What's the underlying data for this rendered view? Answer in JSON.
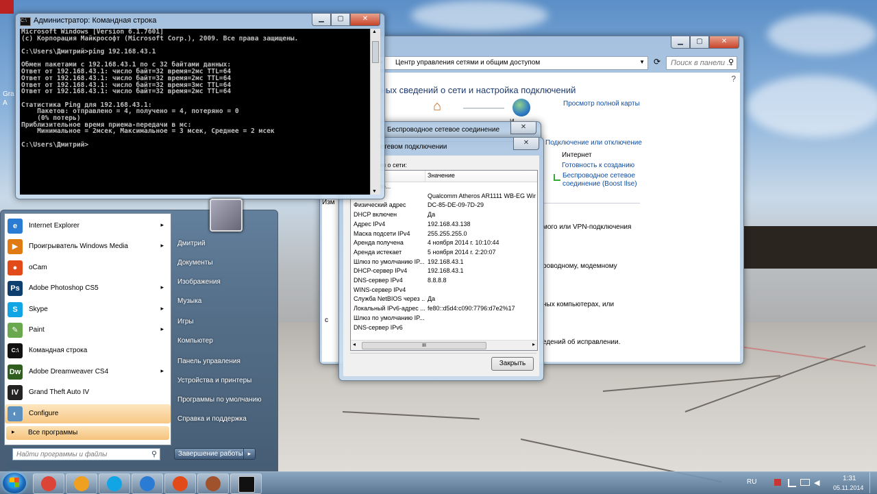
{
  "cmd": {
    "title": "Администратор: Командная строка",
    "lines": [
      "Microsoft Windows [Version 6.1.7601]",
      "(c) Корпорация Майкрософт (Microsoft Corp.), 2009. Все права защищены.",
      "",
      "C:\\Users\\Дмитрий>ping 192.168.43.1",
      "",
      "Обмен пакетами с 192.168.43.1 по с 32 байтами данных:",
      "Ответ от 192.168.43.1: число байт=32 время=2мс TTL=64",
      "Ответ от 192.168.43.1: число байт=32 время=2мс TTL=64",
      "Ответ от 192.168.43.1: число байт=32 время=3мс TTL=64",
      "Ответ от 192.168.43.1: число байт=32 время=2мс TTL=64",
      "",
      "Статистика Ping для 192.168.43.1:",
      "    Пакетов: отправлено = 4, получено = 4, потеряно = 0",
      "    (0% потерь)",
      "Приблизительное время приема-передачи в мс:",
      "    Минимальное = 2мсек, Максимальное = 3 мсек, Среднее = 2 мсек",
      "",
      "C:\\Users\\Дмитрий>"
    ]
  },
  "control_panel": {
    "address": "Центр управления сетями и общим доступом",
    "search_placeholder": "Поиск в панели ...",
    "heading": "ных сведений о сети и настройка подключений",
    "view_map": "Просмотр полной карты",
    "house_label": "",
    "globe_label": "И",
    "connect_disconnect": "Подключение или отключение",
    "internet": "Интернет",
    "ready": "Готовность к созданию",
    "wireless_conn": "Беспроводное сетевое соединение (Boost Ilse)",
    "vpn_text": "мого или VPN-подключения",
    "modem_text": "роводному, модемному",
    "computers_text": "ных компьютерах, или",
    "fix_text": "едений об исправлении.",
    "left_frag1": "Изм",
    "left_frag2": "с"
  },
  "status_dialog": {
    "title": "Беспроводное сетевое соединение"
  },
  "details_dialog": {
    "title": "етевом подключении",
    "label": "ные сведения о сети:",
    "col_prop": "",
    "col_value": "Значение",
    "rows": [
      {
        "prop": "ный для по...",
        "value": ""
      },
      {
        "prop": "",
        "value": "Qualcomm Atheros AR1111 WB-EG Wire"
      },
      {
        "prop": "Физический адрес",
        "value": "DC-85-DE-09-7D-29"
      },
      {
        "prop": "DHCP включен",
        "value": "Да"
      },
      {
        "prop": "Адрес IPv4",
        "value": "192.168.43.138"
      },
      {
        "prop": "Маска подсети IPv4",
        "value": "255.255.255.0"
      },
      {
        "prop": "Аренда получена",
        "value": "4 ноября 2014 г. 10:10:44"
      },
      {
        "prop": "Аренда истекает",
        "value": "5 ноября 2014 г. 2:20:07"
      },
      {
        "prop": "Шлюз по умолчанию IP...",
        "value": "192.168.43.1"
      },
      {
        "prop": "DHCP-сервер IPv4",
        "value": "192.168.43.1"
      },
      {
        "prop": "DNS-сервер IPv4",
        "value": "8.8.8.8"
      },
      {
        "prop": "WINS-сервер IPv4",
        "value": ""
      },
      {
        "prop": "Служба NetBIOS через ...",
        "value": "Да"
      },
      {
        "prop": "Локальный IPv6-адрес ...",
        "value": "fe80::d5d4:c090:7796:d7e2%17"
      },
      {
        "prop": "Шлюз по умолчанию IP...",
        "value": ""
      },
      {
        "prop": "DNS-сервер IPv6",
        "value": ""
      }
    ],
    "scroll_glyph": "III",
    "close_button": "Закрыть"
  },
  "start_menu": {
    "programs": [
      {
        "label": "Internet Explorer",
        "icon": "internet-explorer-icon",
        "glyph": "e",
        "color": "#2a7bd4",
        "arrow": true
      },
      {
        "label": "Проигрыватель Windows Media",
        "icon": "windows-media-player-icon",
        "glyph": "▶",
        "color": "#e07a12",
        "arrow": true
      },
      {
        "label": "oCam",
        "icon": "ocam-icon",
        "glyph": "●",
        "color": "#e24a1a",
        "arrow": false
      },
      {
        "label": "Adobe Photoshop CS5",
        "icon": "photoshop-icon",
        "glyph": "Ps",
        "color": "#0e3f6e",
        "arrow": true
      },
      {
        "label": "Skype",
        "icon": "skype-icon",
        "glyph": "S",
        "color": "#12a5e6",
        "arrow": true
      },
      {
        "label": "Paint",
        "icon": "paint-icon",
        "glyph": "✎",
        "color": "#6aa84f",
        "arrow": true
      },
      {
        "label": "Командная строка",
        "icon": "command-prompt-icon",
        "glyph": "C:\\",
        "color": "#111111",
        "arrow": false
      },
      {
        "label": "Adobe Dreamweaver CS4",
        "icon": "dreamweaver-icon",
        "glyph": "Dw",
        "color": "#2f5e1f",
        "arrow": true
      },
      {
        "label": "Grand Theft Auto IV",
        "icon": "gta-icon",
        "glyph": "IV",
        "color": "#222222",
        "arrow": false
      },
      {
        "label": "Configure",
        "icon": "configure-icon",
        "glyph": "◐",
        "color": "#5a8fc0",
        "arrow": false
      }
    ],
    "all_programs": "Все программы",
    "search_placeholder": "Найти программы и файлы",
    "right_items": [
      "Дмитрий",
      "Документы",
      "Изображения",
      "Музыка",
      "Игры",
      "Компьютер",
      "Панель управления",
      "Устройства и принтеры",
      "Программы по умолчанию",
      "Справка и поддержка"
    ],
    "shutdown": "Завершение работы",
    "shutdown_arrow": "▸"
  },
  "taskbar": {
    "apps": [
      {
        "name": "chrome-icon",
        "color": "#db4437"
      },
      {
        "name": "media-player-icon",
        "color": "#f0a020"
      },
      {
        "name": "skype-icon",
        "color": "#12a5e6"
      },
      {
        "name": "internet-explorer-icon",
        "color": "#2a7bd4"
      },
      {
        "name": "ocam-icon",
        "color": "#e24a1a"
      },
      {
        "name": "game-icon",
        "color": "#a0522d"
      },
      {
        "name": "command-prompt-icon",
        "color": "#111111"
      }
    ],
    "lang": "RU",
    "time": "1:31",
    "date": "05.11.2014"
  },
  "desktop": {
    "icon_label_1": "Gra",
    "icon_label_2": "A"
  }
}
